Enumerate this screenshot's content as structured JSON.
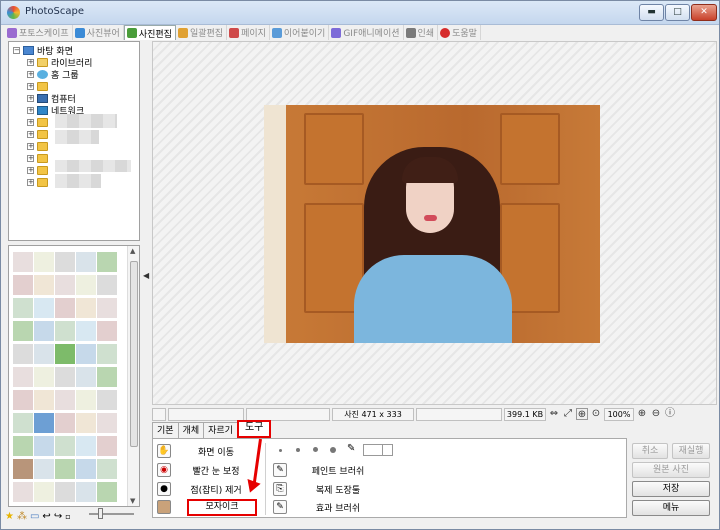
{
  "window": {
    "title": "PhotoScape",
    "buttons": {
      "minimize": "▬",
      "maximize": "□",
      "close": "✕"
    }
  },
  "tabs": [
    {
      "label": "포토스케이프",
      "color": "#9a6bd0"
    },
    {
      "label": "사진뷰어",
      "color": "#3c8bd6"
    },
    {
      "label": "사진편집",
      "color": "#4a9d3a",
      "active": true
    },
    {
      "label": "일괄편집",
      "color": "#e0a132"
    },
    {
      "label": "페이지",
      "color": "#cf4a4a"
    },
    {
      "label": "이어붙이기",
      "color": "#5a9bd8"
    },
    {
      "label": "GIF애니메이션",
      "color": "#7d6bd8"
    },
    {
      "label": "인쇄",
      "color": "#7a7a7a"
    },
    {
      "label": "도움말",
      "color": "#d62b2b"
    }
  ],
  "tree": {
    "root": "바탕 화면",
    "items": [
      "라이브러리",
      "홈 그룹",
      "",
      "컴퓨터",
      "네트워크"
    ]
  },
  "status": {
    "photo_info": "사진 471 x 333",
    "file_size": "399.1 KB",
    "zoom": "100%"
  },
  "bottom_tabs": [
    "기본",
    "개체",
    "자르기",
    "도구"
  ],
  "tools": {
    "left": [
      "화면 이동",
      "빨간 눈 보정",
      "점(잡티) 제거",
      "모자이크"
    ],
    "right": [
      "페인트 브러쉬",
      "복제 도장툴",
      "효과 브러쉬"
    ]
  },
  "right_buttons": {
    "undo": "취소",
    "redo": "재실행",
    "original": "원본 사진",
    "save": "저장",
    "menu": "메뉴"
  },
  "accent": "#e60000"
}
